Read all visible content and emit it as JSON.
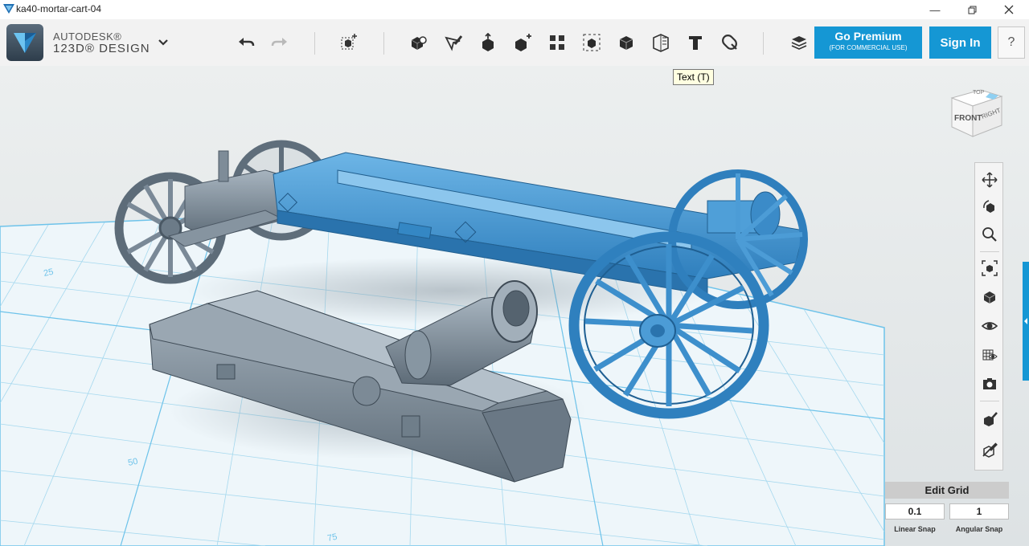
{
  "window": {
    "title": "ka40-mortar-cart-04",
    "controls": [
      "minimize-icon",
      "restore-icon",
      "close-icon"
    ]
  },
  "brand": {
    "line1": "AUTODESK®",
    "line2": "123D® DESIGN"
  },
  "toolbar": {
    "tools": [
      "undo-icon",
      "redo-icon",
      "transform-icon",
      "primitives-icon",
      "sketch-icon",
      "construct-icon",
      "modify-icon",
      "pattern-icon",
      "grouping-icon",
      "combine-icon",
      "measure-icon",
      "text-icon",
      "snap-icon",
      "materials-icon"
    ],
    "premium_label": "Go Premium",
    "premium_sub": "(FOR COMMERCIAL USE)",
    "signin_label": "Sign In",
    "help_label": "?"
  },
  "tooltip": "Text (T)",
  "viewcube": {
    "front": "FRONT",
    "top": "TOP",
    "right": "RIGHT"
  },
  "grid_labels": [
    "25",
    "50",
    "75"
  ],
  "nav_tools": [
    "pan-icon",
    "orbit-icon",
    "zoom-icon",
    "fit-icon",
    "views-icon",
    "visibility-icon",
    "materials-view-icon",
    "snapshot-icon",
    "outline-icon",
    "hide-outline-icon"
  ],
  "edit_grid": {
    "title": "Edit Grid",
    "linear_value": "0.1",
    "angular_value": "1",
    "linear_label": "Linear Snap",
    "angular_label": "Angular Snap"
  },
  "colors": {
    "accent": "#1597d4",
    "selected_model": "#3a8fcb",
    "unselected_model": "#6d7d8c",
    "grid": "#9fd3ea"
  }
}
